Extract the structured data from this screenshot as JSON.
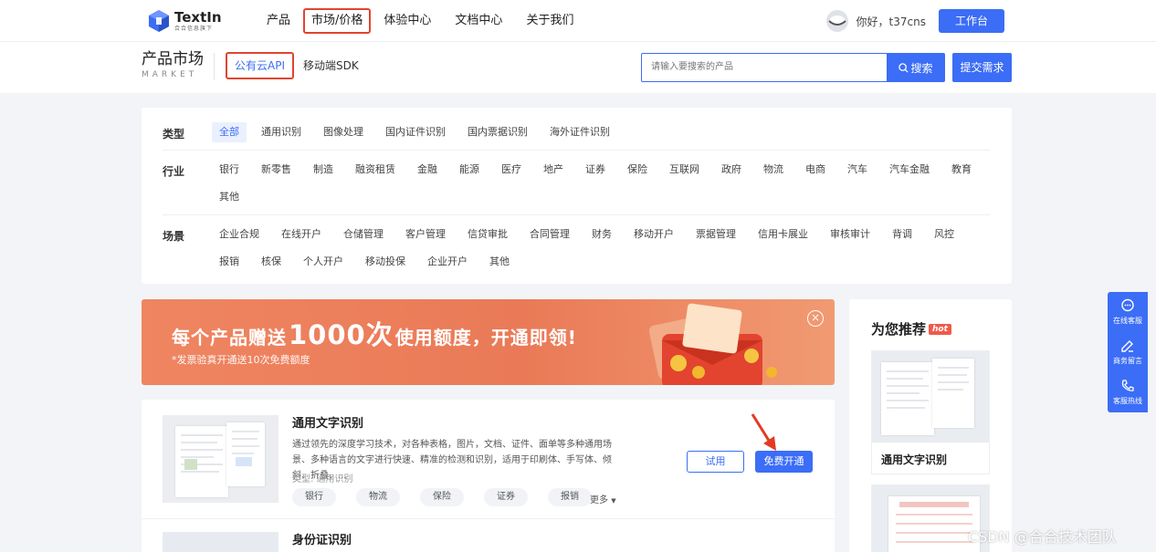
{
  "brand": {
    "name": "TextIn",
    "tagline": "合合信息旗下"
  },
  "nav": {
    "items": [
      {
        "label": "产品",
        "active": false
      },
      {
        "label": "市场/价格",
        "active": true
      },
      {
        "label": "体验中心",
        "active": false
      },
      {
        "label": "文档中心",
        "active": false
      },
      {
        "label": "关于我们",
        "active": false
      }
    ],
    "greeting": "你好，t37cns",
    "workbench": "工作台"
  },
  "market": {
    "title": "产品市场",
    "title_en": "MARKET",
    "tabs": [
      {
        "label": "公有云API",
        "active": true
      },
      {
        "label": "移动端SDK",
        "active": false
      }
    ],
    "search_placeholder": "请输入要搜索的产品",
    "search_button": "搜索",
    "submit_button": "提交需求"
  },
  "filters": {
    "type": {
      "label": "类型",
      "options": [
        "全部",
        "通用识别",
        "图像处理",
        "国内证件识别",
        "国内票据识别",
        "海外证件识别"
      ],
      "active": 0
    },
    "industry": {
      "label": "行业",
      "options": [
        "银行",
        "新零售",
        "制造",
        "融资租赁",
        "金融",
        "能源",
        "医疗",
        "地产",
        "证券",
        "保险",
        "互联网",
        "政府",
        "物流",
        "电商",
        "汽车",
        "汽车金融",
        "教育",
        "其他"
      ]
    },
    "scene": {
      "label": "场景",
      "options": [
        "企业合规",
        "在线开户",
        "仓储管理",
        "客户管理",
        "信贷审批",
        "合同管理",
        "财务",
        "移动开户",
        "票据管理",
        "信用卡展业",
        "审核审计",
        "背调",
        "风控",
        "报销",
        "核保",
        "个人开户",
        "移动投保",
        "企业开户",
        "其他"
      ]
    }
  },
  "banner": {
    "title_pre": "每个产品赠送",
    "title_num": "1000次",
    "title_post": "使用额度，开通即领!",
    "subtitle": "*发票验真开通送10次免费额度",
    "close": "×"
  },
  "products": [
    {
      "name": "通用文字识别",
      "description": "通过领先的深度学习技术，对各种表格，图片，文档、证件、面单等多种通用场景、多种语言的文字进行快速、精准的检测和识别，适用于印刷体、手写体、倾斜、折叠、...",
      "type": "类型: 通用识别",
      "tags": [
        "银行",
        "物流",
        "保险",
        "证券",
        "报销"
      ],
      "more": "更多",
      "try_label": "试用",
      "open_label": "免费开通"
    },
    {
      "name": "身份证识别"
    }
  ],
  "recommend": {
    "title": "为您推荐",
    "badge": "hot",
    "items": [
      {
        "name": "通用文字识别"
      }
    ]
  },
  "service": {
    "items": [
      {
        "label": "在线客服",
        "icon": "chat-icon"
      },
      {
        "label": "商务留言",
        "icon": "edit-icon"
      },
      {
        "label": "客服热线",
        "icon": "phone-icon"
      }
    ]
  },
  "watermark": "CSDN @合合技术团队",
  "colors": {
    "primary": "#3b6df6",
    "highlight": "#e0452f",
    "banner": "#ea7a57"
  }
}
